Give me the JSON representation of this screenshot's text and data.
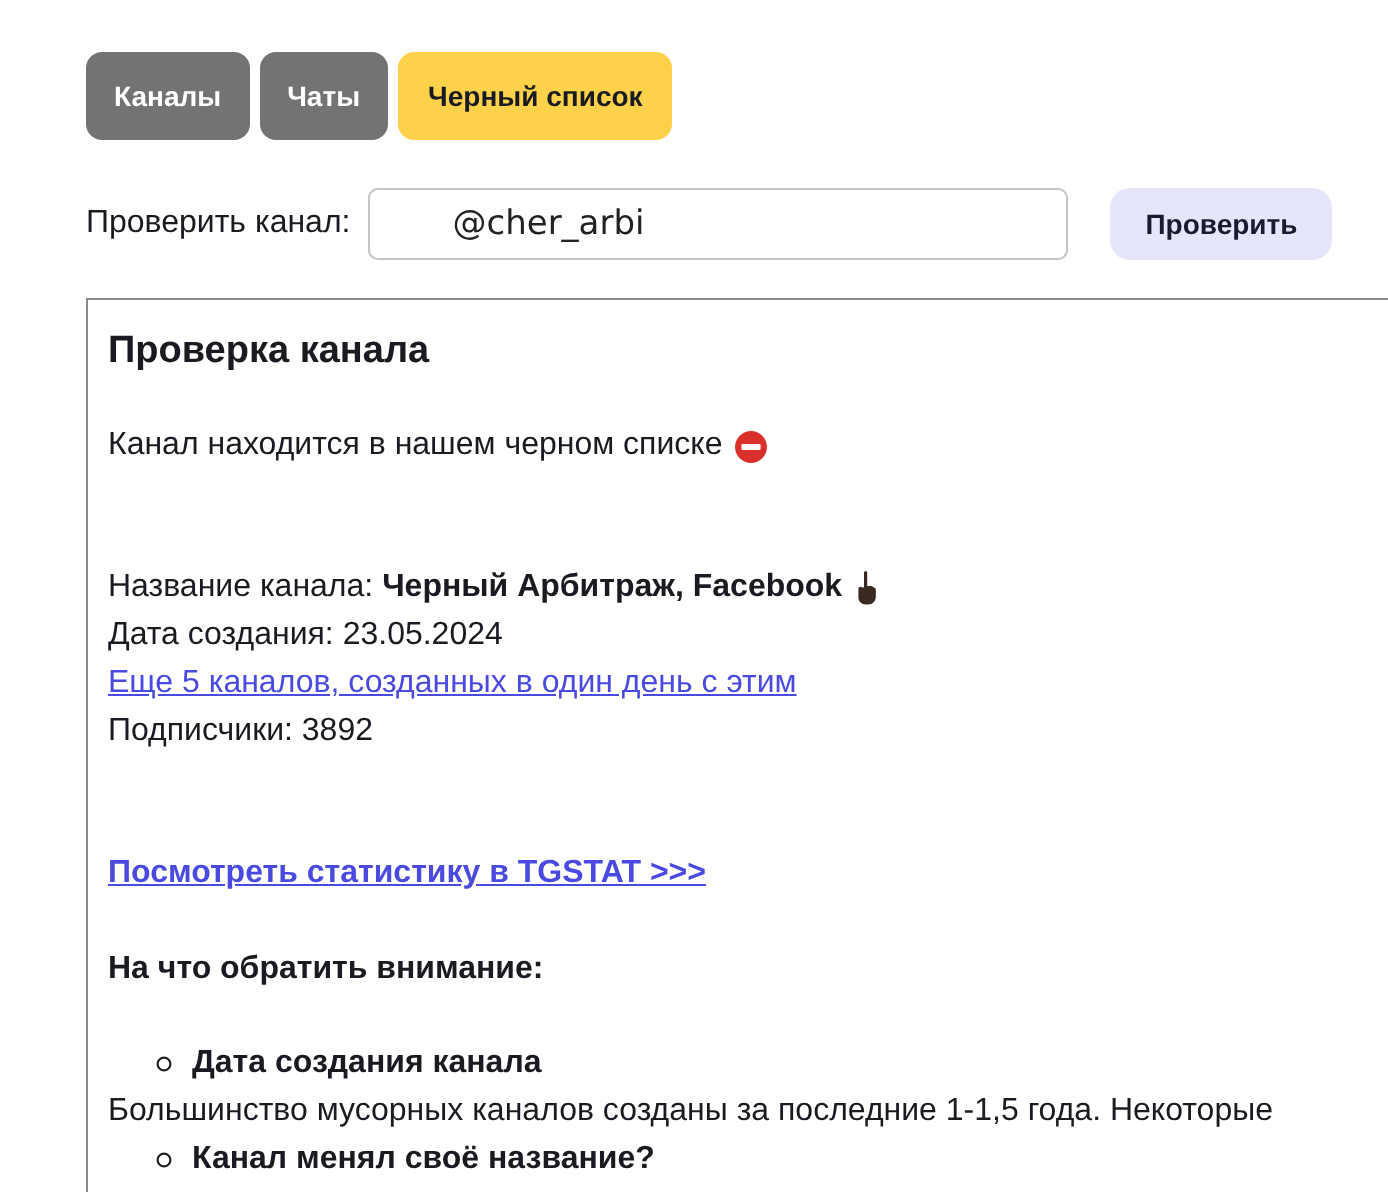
{
  "tabs": [
    {
      "label": "Каналы",
      "selected": false
    },
    {
      "label": "Чаты",
      "selected": false
    },
    {
      "label": "Черный список",
      "selected": true
    }
  ],
  "check_form": {
    "label": "Проверить канал:",
    "value": "@cher_arbi",
    "button": "Проверить"
  },
  "result": {
    "title": "Проверка канала",
    "status": "Канал находится в нашем черном списке",
    "details": [
      {
        "kind": "text",
        "text": "Название канала: **Черный Арбитраж, Facebook**"
      },
      {
        "kind": "text",
        "text": "Дата создания: 23.05.2024"
      },
      {
        "kind": "link",
        "text": "Еще 5 каналов, созданных в один день с этим"
      },
      {
        "kind": "text",
        "text": "Подписчики: 3892"
      }
    ],
    "stats_link": "Посмотреть статистику в TGSTAT >>>",
    "attention_title": "На что обратить внимание:",
    "attention_items": [
      {
        "title": "Дата создания канала",
        "description": "Большинство мусорных каналов созданы за последние 1-1,5 года. Некоторые"
      },
      {
        "title": "Канал менял своё название?"
      }
    ]
  }
}
